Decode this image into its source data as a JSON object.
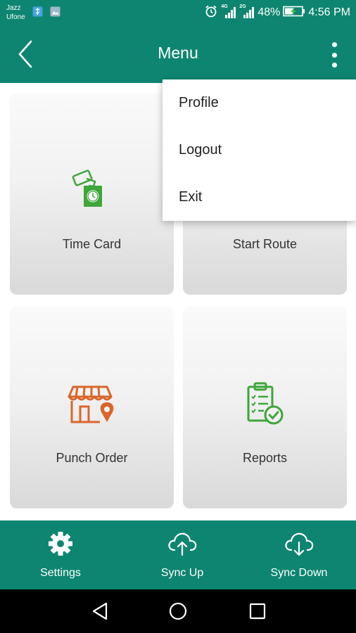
{
  "status_bar": {
    "carrier_1": "Jazz",
    "carrier_2": "Ufone",
    "network_1": "4G",
    "network_2": "2G",
    "battery": "48%",
    "time": "4:56 PM"
  },
  "app_bar": {
    "title": "Menu"
  },
  "menu_tiles": [
    {
      "label": "Time Card",
      "icon": "time-card-icon"
    },
    {
      "label": "Start Route",
      "icon": "route-icon"
    },
    {
      "label": "Punch Order",
      "icon": "shop-location-icon"
    },
    {
      "label": "Reports",
      "icon": "clipboard-check-icon"
    }
  ],
  "overflow_menu": {
    "items": [
      "Profile",
      "Logout",
      "Exit"
    ]
  },
  "bottom_nav": {
    "items": [
      {
        "label": "Settings",
        "icon": "gear-icon"
      },
      {
        "label": "Sync Up",
        "icon": "cloud-upload-icon"
      },
      {
        "label": "Sync Down",
        "icon": "cloud-download-icon"
      }
    ]
  },
  "colors": {
    "primary": "#0e8571",
    "green_icon": "#3ea63a",
    "orange_icon": "#d9662b"
  }
}
